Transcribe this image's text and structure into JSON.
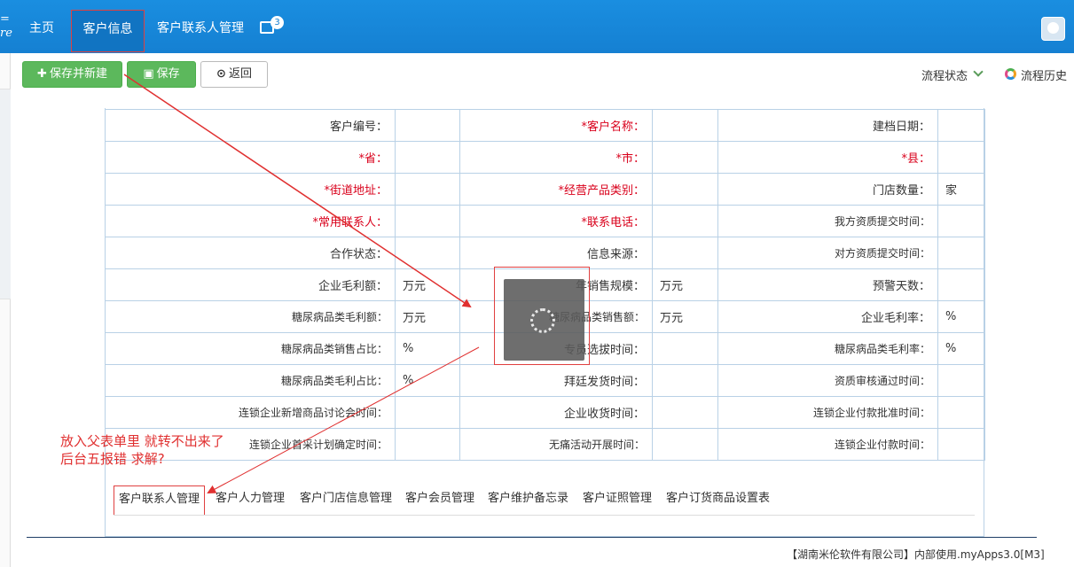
{
  "nav": {
    "brand": "=\nre",
    "items": [
      {
        "label": "主页"
      },
      {
        "label": "客户信息"
      },
      {
        "label": "客户联系人管理"
      }
    ],
    "badge": "3"
  },
  "toolbar": {
    "save_new": "保存并新建",
    "save": "保存",
    "back": "返回",
    "flow_status": "流程状态",
    "flow_history": "流程历史"
  },
  "form": {
    "rows": [
      [
        {
          "label": "客户编号：",
          "req": false,
          "value": ""
        },
        {
          "label": "*客户名称：",
          "req": true,
          "value": ""
        },
        {
          "label": "建档日期：",
          "req": false,
          "value": ""
        }
      ],
      [
        {
          "label": "*省：",
          "req": true,
          "value": ""
        },
        {
          "label": "*市：",
          "req": true,
          "value": ""
        },
        {
          "label": "*县：",
          "req": true,
          "value": ""
        }
      ],
      [
        {
          "label": "*街道地址：",
          "req": true,
          "value": ""
        },
        {
          "label": "*经营产品类别：",
          "req": true,
          "value": ""
        },
        {
          "label": "门店数量：",
          "req": false,
          "value": "家"
        }
      ],
      [
        {
          "label": "*常用联系人：",
          "req": true,
          "value": ""
        },
        {
          "label": "*联系电话：",
          "req": true,
          "value": ""
        },
        {
          "label": "我方资质提交时间：",
          "req": false,
          "value": ""
        }
      ],
      [
        {
          "label": "合作状态：",
          "req": false,
          "value": ""
        },
        {
          "label": "信息来源：",
          "req": false,
          "value": ""
        },
        {
          "label": "对方资质提交时间：",
          "req": false,
          "value": ""
        }
      ],
      [
        {
          "label": "企业毛利额：",
          "req": false,
          "value": "万元"
        },
        {
          "label": "年销售规模：",
          "req": false,
          "value": "万元"
        },
        {
          "label": "预警天数：",
          "req": false,
          "value": ""
        }
      ],
      [
        {
          "label": "糖尿病品类毛利额：",
          "req": false,
          "value": "万元"
        },
        {
          "label": "糖尿病品类销售额：",
          "req": false,
          "value": "万元"
        },
        {
          "label": "企业毛利率：",
          "req": false,
          "value": "%"
        }
      ],
      [
        {
          "label": "糖尿病品类销售占比：",
          "req": false,
          "value": "%"
        },
        {
          "label": "专员选拔时间：",
          "req": false,
          "value": ""
        },
        {
          "label": "糖尿病品类毛利率：",
          "req": false,
          "value": "%"
        }
      ],
      [
        {
          "label": "糖尿病品类毛利占比：",
          "req": false,
          "value": "%"
        },
        {
          "label": "拜廷发货时间：",
          "req": false,
          "value": ""
        },
        {
          "label": "资质审核通过时间：",
          "req": false,
          "value": ""
        }
      ],
      [
        {
          "label": "连锁企业新增商品讨论会时间：",
          "req": false,
          "value": ""
        },
        {
          "label": "企业收货时间：",
          "req": false,
          "value": ""
        },
        {
          "label": "连锁企业付款批准时间：",
          "req": false,
          "value": ""
        }
      ],
      [
        {
          "label": "连锁企业首采计划确定时间：",
          "req": false,
          "value": ""
        },
        {
          "label": "无痛活动开展时间：",
          "req": false,
          "value": ""
        },
        {
          "label": "连锁企业付款时间：",
          "req": false,
          "value": ""
        }
      ]
    ]
  },
  "tabs": [
    {
      "label": "客户联系人管理"
    },
    {
      "label": "客户人力管理"
    },
    {
      "label": "客户门店信息管理"
    },
    {
      "label": "客户会员管理"
    },
    {
      "label": "客户维护备忘录"
    },
    {
      "label": "客户证照管理"
    },
    {
      "label": "客户订货商品设置表"
    }
  ],
  "annotation": "放入父表单里 就转不出来了\n后台五报错 求解?",
  "footer": "【湖南米伦软件有限公司】内部使用.myApps3.0[M3]",
  "colors": {
    "nav_bg": "#1580d2",
    "green": "#5cb85c",
    "required": "#d9001b",
    "annotation": "#e03030"
  }
}
